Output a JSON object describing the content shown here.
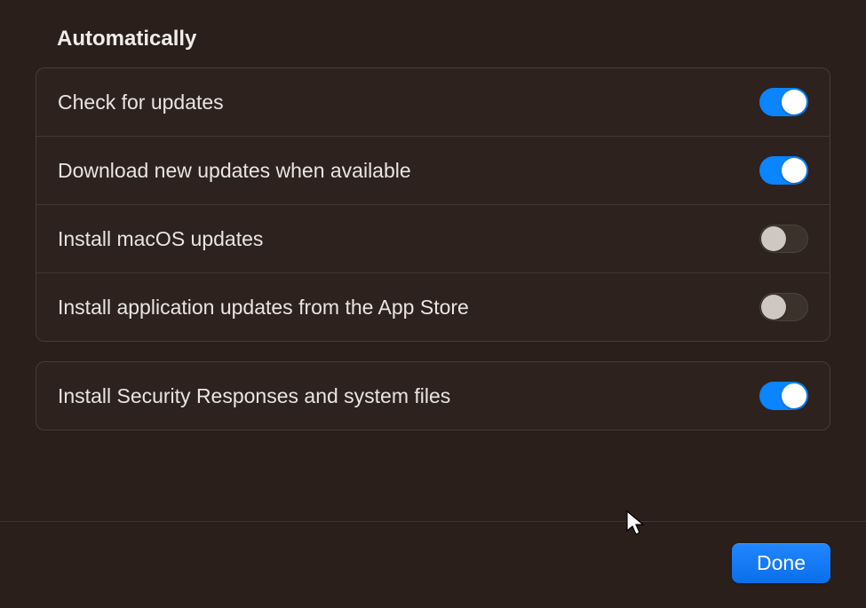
{
  "section_title": "Automatically",
  "group1": {
    "rows": [
      {
        "label": "Check for updates",
        "on": true
      },
      {
        "label": "Download new updates when available",
        "on": true
      },
      {
        "label": "Install macOS updates",
        "on": false
      },
      {
        "label": "Install application updates from the App Store",
        "on": false
      }
    ]
  },
  "group2": {
    "rows": [
      {
        "label": "Install Security Responses and system files",
        "on": true
      }
    ]
  },
  "footer": {
    "done_label": "Done"
  }
}
